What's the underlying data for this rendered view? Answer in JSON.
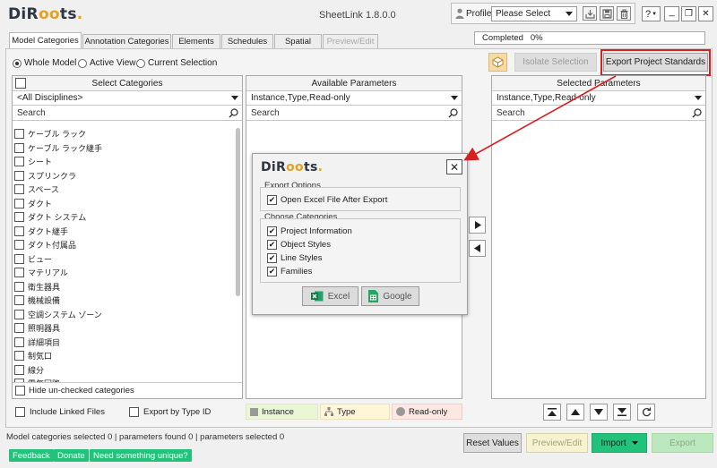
{
  "window": {
    "title": "SheetLink 1.8.0.0"
  },
  "brand": {
    "accent": "#e8a020",
    "dark": "#2d3642"
  },
  "top_right": {
    "profile_label": "Profile",
    "profile_select": "Please Select",
    "help_label": "?",
    "minimize_glyph": "_",
    "maximize_glyph": "❐",
    "close_glyph": "✕"
  },
  "tabs": [
    {
      "label": "Model Categories",
      "state": "active"
    },
    {
      "label": "Annotation Categories",
      "state": "normal"
    },
    {
      "label": "Elements",
      "state": "normal"
    },
    {
      "label": "Schedules",
      "state": "normal"
    },
    {
      "label": "Spatial",
      "state": "normal"
    },
    {
      "label": "Preview/Edit",
      "state": "disabled"
    }
  ],
  "status": {
    "completed": "Completed   0%"
  },
  "scope": {
    "options": [
      "Whole Model",
      "Active View",
      "Current Selection"
    ],
    "selected": "Whole Model"
  },
  "toolbar": {
    "isolate_label": "Isolate Selection",
    "export_standards_label": "Export Project Standards"
  },
  "categories_panel": {
    "header": "Select Categories",
    "discipline": "<All Disciplines>",
    "search_placeholder": "Search",
    "items": [
      "ケーブル ラック",
      "ケーブル ラック継手",
      "シート",
      "スプリンクラ",
      "スペース",
      "ダクト",
      "ダクト システム",
      "ダクト継手",
      "ダクト付属品",
      "ビュー",
      "マテリアル",
      "衛生器具",
      "機械設備",
      "空調システム ゾーン",
      "照明器具",
      "詳細項目",
      "制気口",
      "線分",
      "電気回路"
    ],
    "hide_unchecked": "Hide un-checked categories"
  },
  "available_panel": {
    "header": "Available Parameters",
    "filter": "Instance,Type,Read-only",
    "search_placeholder": "Search"
  },
  "selected_panel": {
    "header": "Selected Parameters",
    "filter": "Instance,Type,Read-only",
    "search_placeholder": "Search"
  },
  "options": {
    "include_linked": "Include Linked Files",
    "export_by_type": "Export by Type ID"
  },
  "legend": {
    "instance": "Instance",
    "type": "Type",
    "readonly": "Read-only"
  },
  "footer": {
    "status_text": "Model categories selected 0 | parameters found 0 | parameters selected 0",
    "reset_label": "Reset Values",
    "preview_label": "Preview/Edit",
    "import_label": "Import",
    "export_label": "Export",
    "feedback": "Feedback",
    "donate": "Donate",
    "unique": "Need something unique?"
  },
  "dialog": {
    "export_options_title": "Export Options",
    "open_after": "Open Excel File After Export",
    "choose_categories_title": "Choose Categories",
    "categories": [
      "Project Information",
      "Object Styles",
      "Line Styles",
      "Families"
    ],
    "excel_label": "Excel",
    "google_label": "Google",
    "close_glyph": "✕"
  },
  "logo": {
    "part1": "DiR",
    "part2": "oo",
    "part3": "ts",
    "dot": "."
  }
}
